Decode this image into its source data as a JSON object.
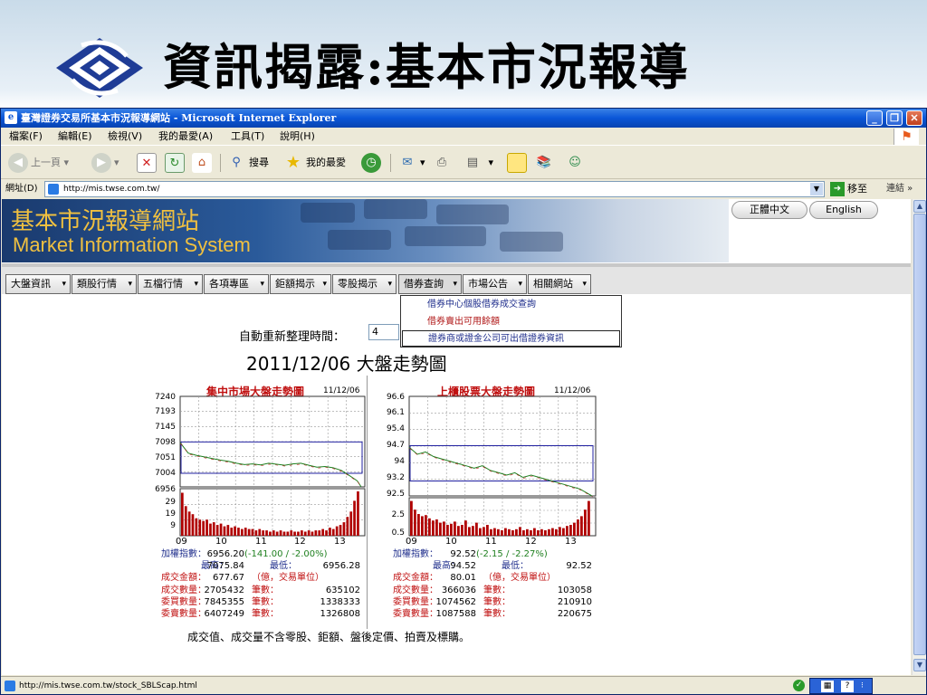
{
  "slide": {
    "title": "資訊揭露:基本市況報導"
  },
  "window": {
    "title": "臺灣證券交易所基本市況報導網站 - Microsoft Internet Explorer",
    "controls": [
      "_",
      "❐",
      "✕"
    ]
  },
  "menu": [
    "檔案(F)",
    "編輯(E)",
    "檢視(V)",
    "我的最愛(A)",
    "工具(T)",
    "說明(H)"
  ],
  "toolbar": {
    "back": "上一頁",
    "search": "搜尋",
    "favorites": "我的最愛"
  },
  "address": {
    "label": "網址(D)",
    "url": "http://mis.twse.com.tw/",
    "go": "移至",
    "links": "連結"
  },
  "site": {
    "name_cn": "基本市況報導網站",
    "name_en": "Market Information System",
    "lang_cn": "正體中文",
    "lang_en": "English"
  },
  "nav": [
    "大盤資訊",
    "類股行情",
    "五檔行情",
    "各項專區",
    "鉅額揭示",
    "零股揭示",
    "借券查詢",
    "市場公告",
    "相關網站"
  ],
  "dropdown": [
    "借券中心個股借券成交查詢",
    "借券賣出可用餘額",
    "證券商或證金公司可出借證券資訊"
  ],
  "refresh": {
    "label": "自動重新整理時間：",
    "value": "4"
  },
  "page_title": "2011/12/06 大盤走勢圖",
  "charts": [
    {
      "title": "集中市場大盤走勢圖",
      "date": "11/12/06",
      "yticks_price": [
        "7240",
        "7193",
        "7145",
        "7098",
        "7051",
        "7004",
        "6956"
      ],
      "yticks_vol": [
        "29",
        "19",
        "9"
      ],
      "xticks": [
        "09",
        "10",
        "11",
        "12",
        "13"
      ],
      "stats": [
        [
          "加權指數：",
          "6956.20",
          "(-141.00 / -2.00%)",
          ""
        ],
        [
          "最高：",
          "7075.84",
          "最低：",
          "6956.28"
        ],
        [
          "成交金額：",
          "677.67",
          "（億，交易單位）",
          ""
        ],
        [
          "成交數量：",
          "2705432",
          "筆數：",
          "635102"
        ],
        [
          "委買數量：",
          "7845355",
          "筆數：",
          "1338333"
        ],
        [
          "委賣數量：",
          "6407249",
          "筆數：",
          "1326808"
        ]
      ]
    },
    {
      "title": "上櫃股票大盤走勢圖",
      "date": "11/12/06",
      "yticks_price": [
        "96.6",
        "96.1",
        "95.4",
        "94.7",
        "94",
        "93.2",
        "92.5"
      ],
      "yticks_vol": [
        "2.5",
        "0.5"
      ],
      "xticks": [
        "09",
        "10",
        "11",
        "12",
        "13"
      ],
      "stats": [
        [
          "加權指數：",
          "92.52",
          "(-2.15 / -2.27%)",
          ""
        ],
        [
          "最高：",
          "94.52",
          "最低：",
          "92.52"
        ],
        [
          "成交金額：",
          "80.01",
          "（億，交易單位）",
          ""
        ],
        [
          "成交數量：",
          "366036",
          "筆數：",
          "103058"
        ],
        [
          "委買數量：",
          "1074562",
          "筆數：",
          "210910"
        ],
        [
          "委賣數量：",
          "1087588",
          "筆數：",
          "220675"
        ]
      ]
    }
  ],
  "footnote": "成交值、成交量不含零股、鉅額、盤後定價、拍賣及標購。",
  "status": {
    "url": "http://mis.twse.com.tw/stock_SBLScap.html"
  },
  "chart_data": [
    {
      "type": "line",
      "title": "集中市場大盤走勢圖",
      "ylim": [
        6956,
        7240
      ],
      "xlim": [
        9,
        13.5
      ],
      "x": [
        9.0,
        9.2,
        9.4,
        9.6,
        9.8,
        10.0,
        10.2,
        10.4,
        10.6,
        10.8,
        11.0,
        11.2,
        11.4,
        11.6,
        11.8,
        12.0,
        12.2,
        12.4,
        12.6,
        12.8,
        13.0,
        13.2,
        13.4,
        13.5
      ],
      "values": [
        7095,
        7062,
        7055,
        7050,
        7045,
        7040,
        7036,
        7030,
        7026,
        7028,
        7025,
        7030,
        7027,
        7024,
        7028,
        7030,
        7024,
        7018,
        7020,
        7016,
        7008,
        6992,
        6975,
        6956
      ],
      "reference": 7097,
      "volume": {
        "ylim": [
          0,
          35
        ],
        "values": [
          32,
          22,
          18,
          16,
          13,
          12,
          11,
          12,
          9,
          10,
          8,
          9,
          7,
          8,
          6,
          7,
          6,
          5,
          6,
          5,
          5,
          4,
          5,
          4,
          4,
          3,
          4,
          3,
          4,
          3,
          3,
          4,
          3,
          3,
          4,
          3,
          4,
          3,
          4,
          4,
          5,
          4,
          6,
          5,
          7,
          8,
          10,
          14,
          18,
          26,
          33
        ]
      }
    },
    {
      "type": "line",
      "title": "上櫃股票大盤走勢圖",
      "ylim": [
        92.5,
        96.8
      ],
      "xlim": [
        9,
        13.5
      ],
      "x": [
        9.0,
        9.2,
        9.4,
        9.6,
        9.8,
        10.0,
        10.2,
        10.4,
        10.6,
        10.8,
        11.0,
        11.2,
        11.4,
        11.6,
        11.8,
        12.0,
        12.2,
        12.4,
        12.6,
        12.8,
        13.0,
        13.2,
        13.4,
        13.5
      ],
      "values": [
        94.6,
        94.3,
        94.4,
        94.2,
        94.1,
        94.0,
        93.9,
        93.8,
        93.7,
        93.8,
        93.6,
        93.5,
        93.4,
        93.5,
        93.3,
        93.4,
        93.3,
        93.2,
        93.1,
        93.0,
        92.9,
        92.8,
        92.6,
        92.5
      ],
      "reference": 94.67,
      "volume": {
        "ylim": [
          0,
          3.5
        ],
        "values": [
          3.2,
          2.4,
          2.0,
          1.8,
          1.9,
          1.6,
          1.4,
          1.5,
          1.2,
          1.3,
          1.0,
          1.1,
          1.3,
          0.9,
          1.0,
          1.4,
          0.8,
          0.9,
          1.2,
          0.7,
          0.8,
          1.0,
          0.6,
          0.7,
          0.6,
          0.5,
          0.7,
          0.6,
          0.5,
          0.6,
          0.8,
          0.5,
          0.6,
          0.5,
          0.7,
          0.5,
          0.6,
          0.5,
          0.6,
          0.7,
          0.6,
          0.8,
          0.7,
          0.9,
          1.0,
          1.2,
          1.5,
          1.8,
          2.4,
          3.2
        ]
      }
    }
  ]
}
